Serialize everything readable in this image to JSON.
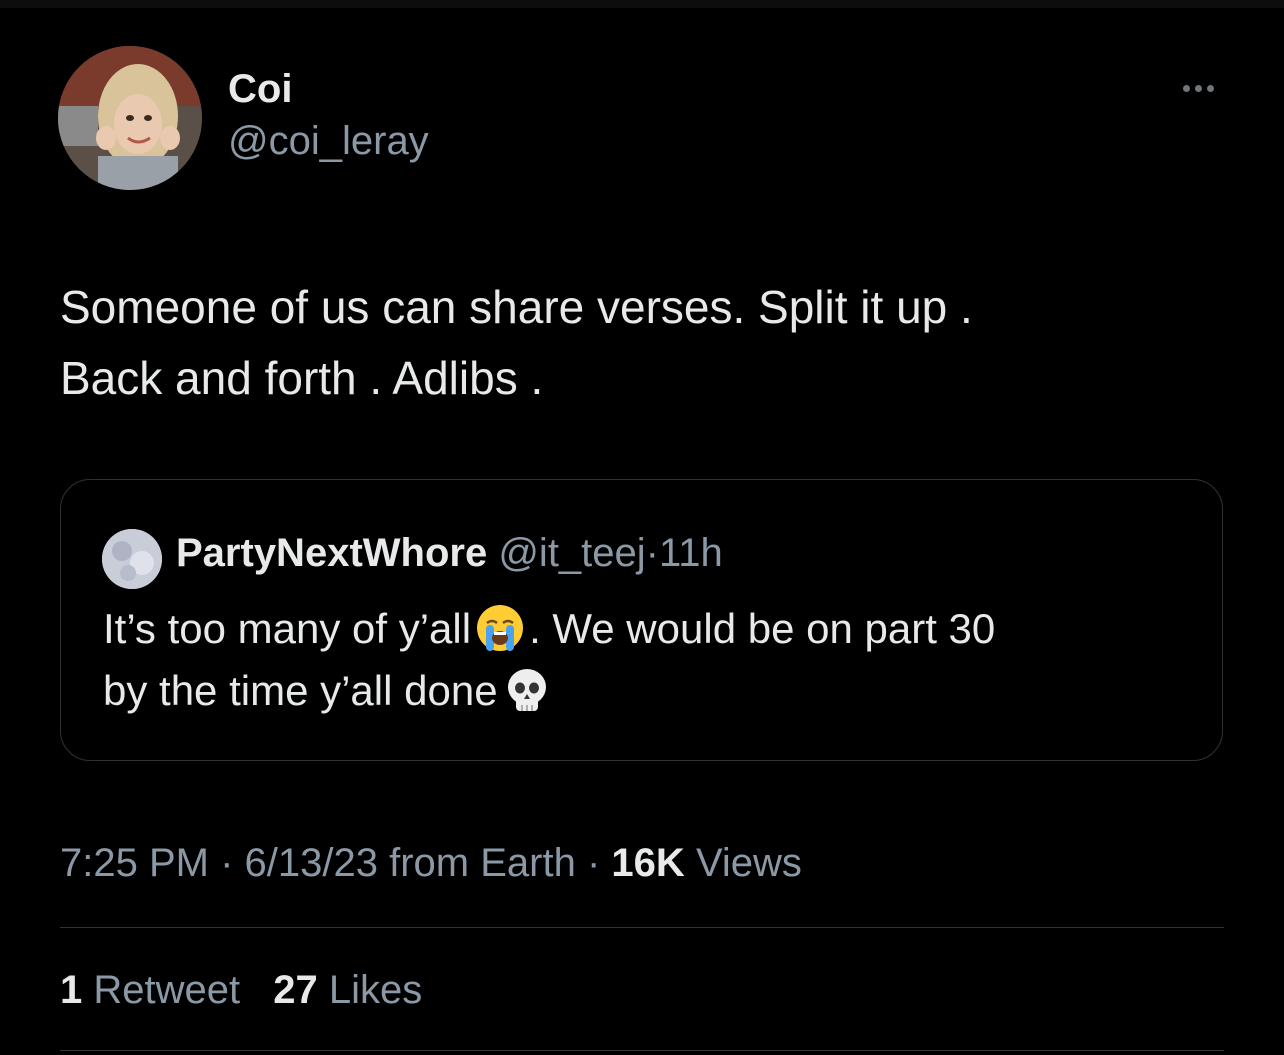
{
  "tweet": {
    "author": {
      "display_name": "Coi",
      "handle": "@coi_leray",
      "avatar_icon": "user-avatar-photo"
    },
    "more_icon": "more-options-icon",
    "text_line1": "Someone of us can share verses. Split it up .",
    "text_line2": "Back and forth . Adlibs .",
    "quote": {
      "display_name": "PartyNextWhore",
      "handle": "@it_teej",
      "separator": "·",
      "time": "11h",
      "text_part1": "It’s too many of y’all",
      "emoji1": "loudly-crying-face-emoji",
      "text_part2": ". We would be on part 30",
      "text_part3": "by the time y’all done",
      "emoji2": "skull-emoji"
    },
    "meta": {
      "time": "7:25 PM",
      "sep1": "·",
      "date_source": "6/13/23 from Earth",
      "sep2": "·",
      "views_count": "16K",
      "views_label": "Views"
    },
    "stats": {
      "retweets_count": "1",
      "retweets_label": "Retweet",
      "likes_count": "27",
      "likes_label": "Likes"
    }
  },
  "colors": {
    "background": "#000000",
    "primary_text": "#e7e9ea",
    "secondary_text": "#8b98a5",
    "border": "#2f3336"
  }
}
